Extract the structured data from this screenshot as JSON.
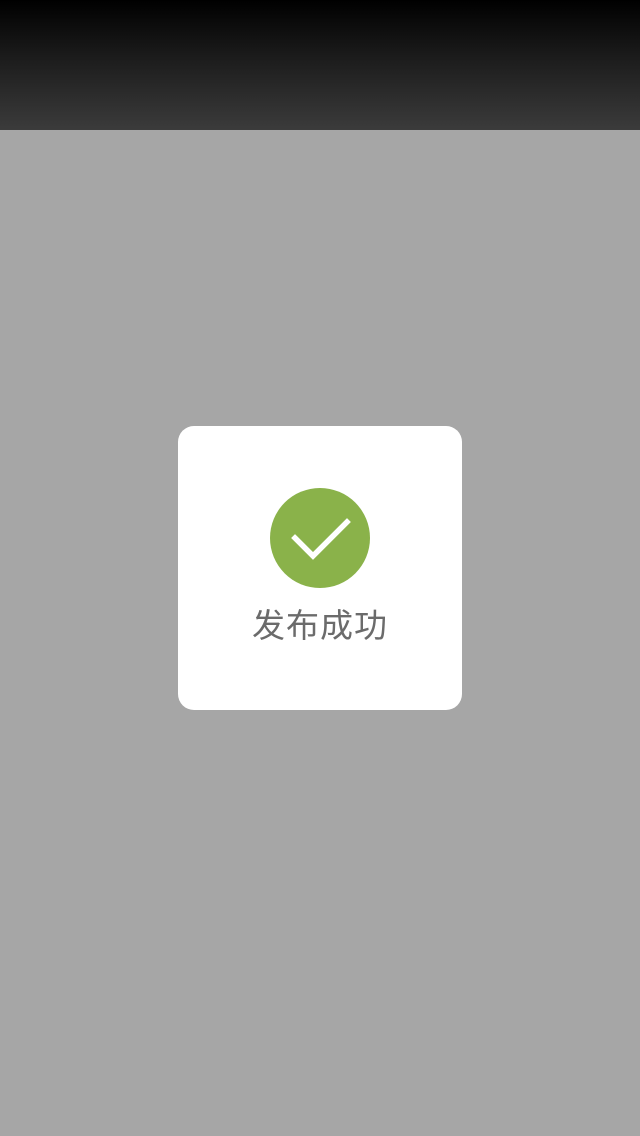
{
  "toast": {
    "message": "发布成功",
    "icon": "check-circle-icon",
    "icon_color": "#8ab24a"
  },
  "colors": {
    "backdrop": "#a6a6a6",
    "toast_bg": "#ffffff",
    "text": "#6b6b6b"
  }
}
